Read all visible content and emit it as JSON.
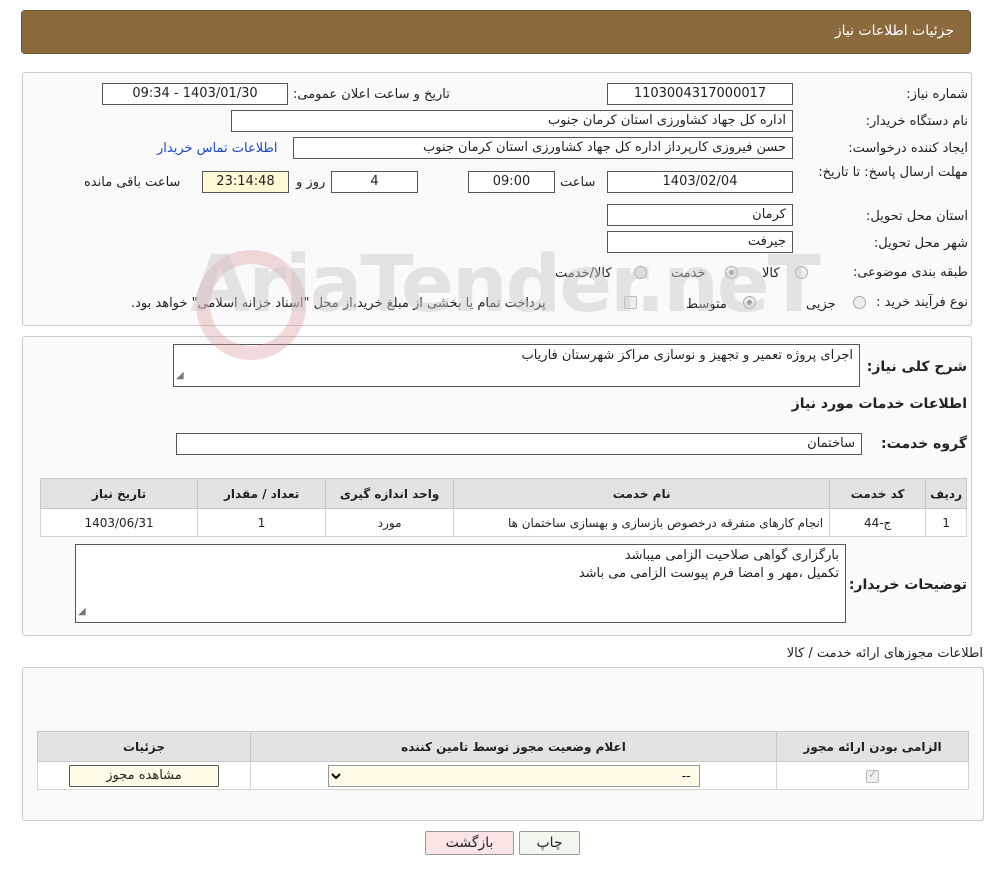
{
  "header": {
    "title": "جزئیات اطلاعات نیاز"
  },
  "form": {
    "need_number_label": "شماره نیاز:",
    "need_number": "1103004317000017",
    "announce_label": "تاریخ و ساعت اعلان عمومی:",
    "announce_value": "1403/01/30 - 09:34",
    "buyer_org_label": "نام دستگاه خریدار:",
    "buyer_org": "اداره کل جهاد کشاورزی استان کرمان   جنوب",
    "creator_label": "ایجاد کننده درخواست:",
    "creator": "حسن فیروزی کارپرداز اداره کل جهاد کشاورزی استان کرمان   جنوب",
    "contact_link": "اطلاعات تماس خریدار",
    "deadline_label": "مهلت ارسال پاسخ: تا تاریخ:",
    "deadline_date": "1403/02/04",
    "time_label": "ساعت",
    "deadline_time": "09:00",
    "days_value": "4",
    "days_label": "روز و",
    "remaining_time": "23:14:48",
    "remaining_label": "ساعت باقی مانده",
    "province_label": "استان محل تحویل:",
    "province": "کرمان",
    "city_label": "شهر محل تحویل:",
    "city": "جیرفت",
    "category_label": "طبقه بندی موضوعی:",
    "category_options": [
      "کالا",
      "خدمت",
      "کالا/خدمت"
    ],
    "process_label": "نوع فرآیند خرید :",
    "process_options": [
      "جزیی",
      "متوسط"
    ],
    "process_note": "پرداخت تمام یا بخشی از مبلغ خرید،از محل \"اسناد خزانه اسلامی\" خواهد بود."
  },
  "description": {
    "label": "شرح کلی نیاز:",
    "text": "اجرای پروژه تعمیر و تجهیز و نوسازی مراکز شهرستان فاریاب"
  },
  "services": {
    "section_title": "اطلاعات خدمات مورد نیاز",
    "group_label": "گروه خدمت:",
    "group_value": "ساختمان",
    "table_headers": [
      "ردیف",
      "کد خدمت",
      "نام خدمت",
      "واحد اندازه گیری",
      "تعداد / مقدار",
      "تاریخ نیاز"
    ],
    "rows": [
      [
        "1",
        "ج-44",
        "انجام کارهای متفرقه درخصوص بازسازی و بهسازی ساختمان ها",
        "مورد",
        "1",
        "1403/06/31"
      ]
    ]
  },
  "buyer_notes": {
    "label": "توضیحات خریدار:",
    "line1": "بارگزاری گواهی صلاحیت الزامی میباشد",
    "line2": "تکمیل ،مهر و امضا فرم پیوست الزامی می باشد"
  },
  "permits": {
    "section_title": "اطلاعات مجوزهای ارائه خدمت / کالا",
    "table_headers": [
      "الزامی بودن ارائه مجوز",
      "اعلام وضعیت مجوز توسط تامین کننده",
      "جزئیات"
    ],
    "select_value": "--",
    "view_button": "مشاهده مجوز"
  },
  "buttons": {
    "print": "چاپ",
    "back": "بازگشت"
  },
  "watermark": "AriaTender.neT"
}
